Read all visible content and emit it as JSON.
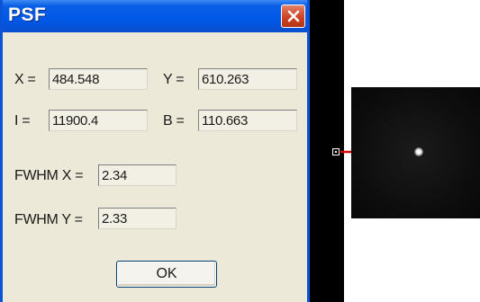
{
  "dialog": {
    "title": "PSF",
    "fields": {
      "x": {
        "label": "X =",
        "value": "484.548"
      },
      "y": {
        "label": "Y =",
        "value": "610.263"
      },
      "i": {
        "label": "I =",
        "value": "11900.4"
      },
      "b": {
        "label": "B =",
        "value": "110.663"
      },
      "fwhm_x": {
        "label": "FWHM X =",
        "value": "2.34"
      },
      "fwhm_y": {
        "label": "FWHM Y =",
        "value": "2.33"
      }
    },
    "ok_label": "OK"
  },
  "colors": {
    "titlebar": "#0058e6",
    "dialog_bg": "#ece9d8",
    "close_button": "#cc4324",
    "arrow": "#e00000"
  },
  "icons": {
    "close": "close-icon",
    "arrow": "arrow-right-icon",
    "marker": "star-marker-icon"
  }
}
